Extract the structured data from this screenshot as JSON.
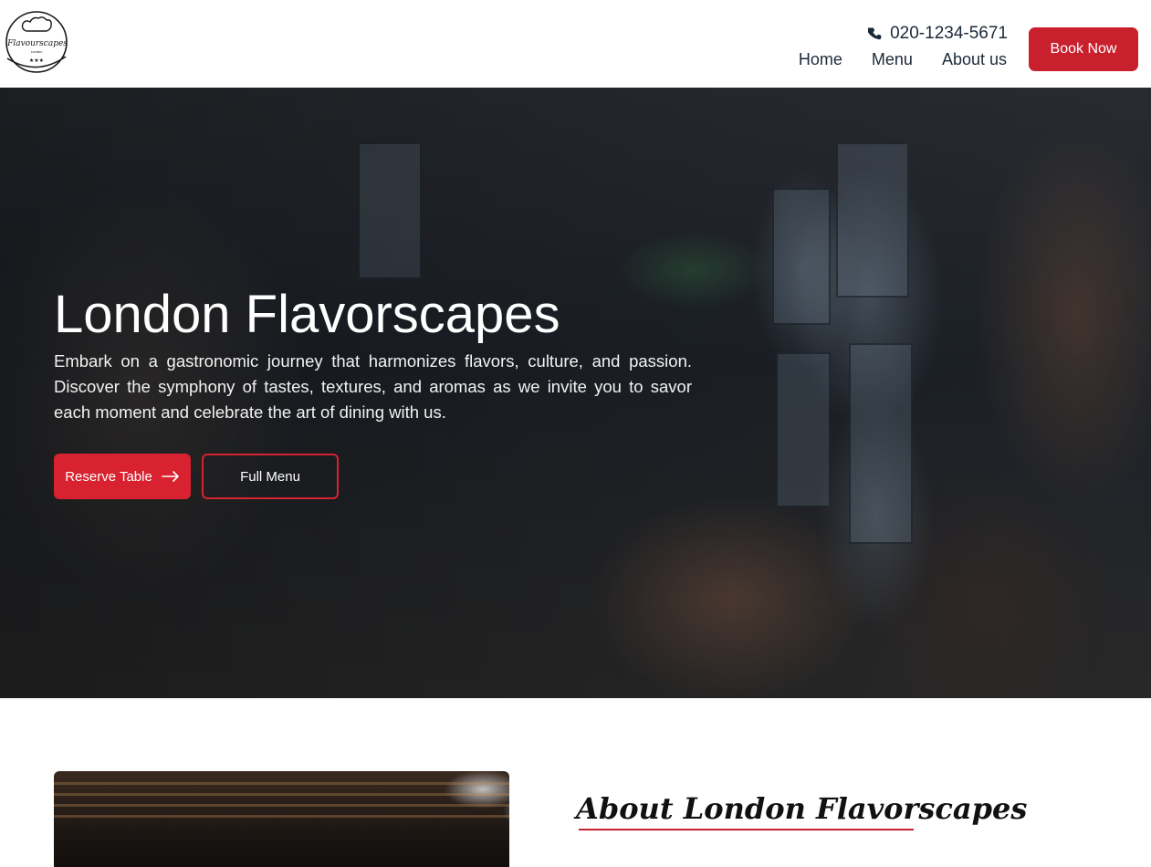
{
  "header": {
    "logo": {
      "brand": "Flavourscapes",
      "sub": "London"
    },
    "phone": "020-1234-5671",
    "nav": [
      "Home",
      "Menu",
      "About us"
    ],
    "book_label": "Book Now"
  },
  "hero": {
    "title": "London Flavorscapes",
    "text": "Embark on a gastronomic journey that harmonizes flavors, culture, and passion. Discover the symphony of tastes, textures, and aromas as we invite you to savor each moment and celebrate the art of dining with us.",
    "reserve_label": "Reserve Table",
    "menu_label": "Full Menu"
  },
  "about": {
    "heading": "About London Flavorscapes"
  },
  "colors": {
    "accent": "#c8202d",
    "nav_text": "#1b2a3a",
    "hero_text": "#ffffff"
  },
  "icons": {
    "phone": "phone-icon",
    "arrow": "arrow-right-icon",
    "logo": "chef-hat-logo"
  }
}
